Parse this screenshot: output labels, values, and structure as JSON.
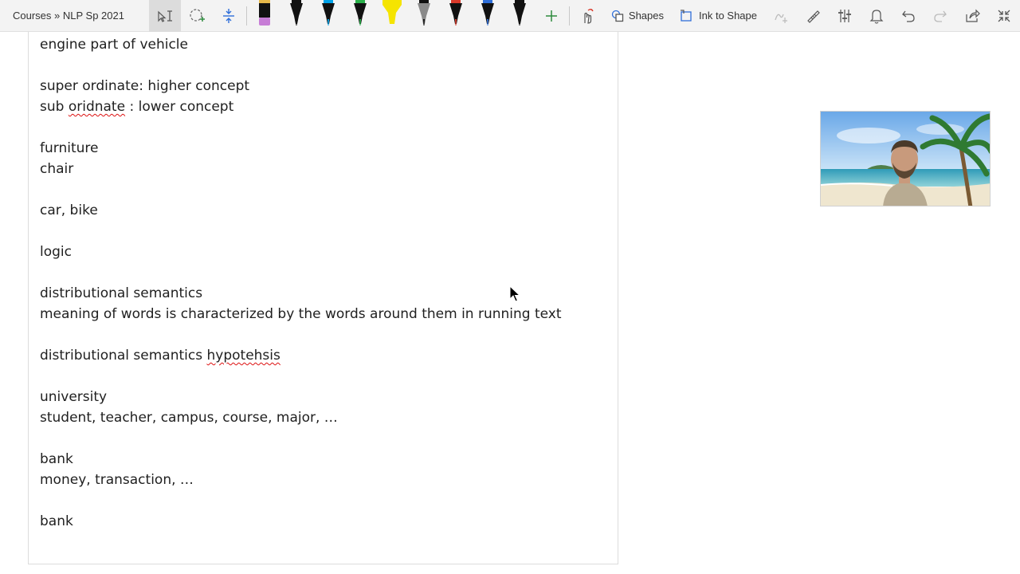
{
  "toolbar": {
    "breadcrumb": "Courses » NLP Sp 2021",
    "shapes_label": "Shapes",
    "ink_to_shape_label": "Ink to Shape",
    "pens": [
      {
        "color": "#c77dd6",
        "body": "#111111"
      },
      {
        "color": "#111111",
        "body": "#111111"
      },
      {
        "color": "#00a2e8",
        "body": "#111111"
      },
      {
        "color": "#2bb14b",
        "body": "#111111"
      },
      {
        "color": "#f5e400",
        "body": "#f5e400"
      },
      {
        "color": "#111111",
        "body": "#8a8a8a"
      },
      {
        "color": "#d93a2b",
        "body": "#111111"
      },
      {
        "color": "#2f6fd9",
        "body": "#111111"
      },
      {
        "color": "#111111",
        "body": "#111111"
      }
    ]
  },
  "notes": {
    "line_01": "engine part of vehicle",
    "line_02": "super ordinate: higher concept",
    "line_03_pre": "sub ",
    "line_03_err": "oridnate",
    "line_03_post": " : lower concept",
    "line_04": "furniture",
    "line_05": "chair",
    "line_06": "car, bike",
    "line_07": "logic",
    "line_08": "distributional semantics",
    "line_09": "meaning of words is characterized by the words around them in running text",
    "line_10_pre": "distributional semantics ",
    "line_10_err": "hypotehsis",
    "line_11": "university",
    "line_12": "student, teacher, campus, course, major, …",
    "line_13": "bank",
    "line_14": "money, transaction, …",
    "line_15": "bank"
  },
  "colors": {
    "toolbar_bg": "#f3f3f3",
    "accent_green": "#2e8b3e",
    "spell_error": "#dd1111"
  }
}
